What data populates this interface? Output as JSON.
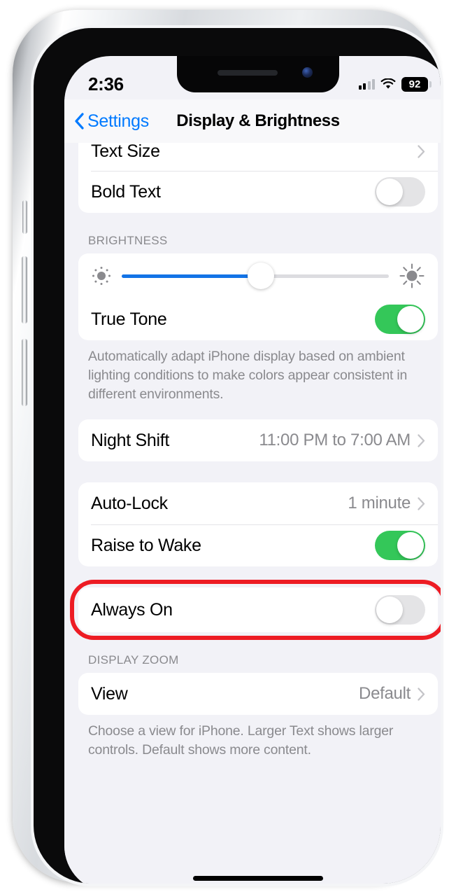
{
  "status_bar": {
    "time": "2:36",
    "battery_percent": "92",
    "wifi_icon": "wifi-icon",
    "signal_icon": "cellular-signal-icon",
    "battery_icon": "battery-icon"
  },
  "nav": {
    "back_label": "Settings",
    "back_icon": "chevron-left-icon",
    "title": "Display & Brightness"
  },
  "groups": {
    "text": {
      "rows": [
        {
          "label": "Text Size",
          "type": "disclosure",
          "value": "",
          "accessory_icon": "chevron-right-icon"
        },
        {
          "label": "Bold Text",
          "type": "toggle",
          "state": "off"
        }
      ]
    },
    "brightness": {
      "header": "BRIGHTNESS",
      "slider": {
        "value_percent": 52,
        "left_icon": "sun-small-icon",
        "right_icon": "sun-large-icon",
        "fill_color": "#1273e6",
        "track_color": "#dcdce0"
      },
      "rows": [
        {
          "label": "True Tone",
          "type": "toggle",
          "state": "on"
        }
      ],
      "footer": "Automatically adapt iPhone display based on ambient lighting conditions to make colors appear consistent in different environments."
    },
    "night_shift": {
      "rows": [
        {
          "label": "Night Shift",
          "type": "disclosure",
          "value": "11:00 PM to 7:00 AM",
          "accessory_icon": "chevron-right-icon"
        }
      ]
    },
    "lock": {
      "rows": [
        {
          "label": "Auto-Lock",
          "type": "disclosure",
          "value": "1 minute",
          "accessory_icon": "chevron-right-icon"
        },
        {
          "label": "Raise to Wake",
          "type": "toggle",
          "state": "on"
        }
      ]
    },
    "always_on": {
      "rows": [
        {
          "label": "Always On",
          "type": "toggle",
          "state": "off"
        }
      ],
      "highlight_color": "#ed1c24"
    },
    "display_zoom": {
      "header": "DISPLAY ZOOM",
      "rows": [
        {
          "label": "View",
          "type": "disclosure",
          "value": "Default",
          "accessory_icon": "chevron-right-icon"
        }
      ],
      "footer": "Choose a view for iPhone. Larger Text shows larger controls. Default shows more content."
    }
  },
  "colors": {
    "accent_blue": "#007aff",
    "toggle_on_green": "#34c759",
    "annotation_red": "#ed1c24",
    "background": "#f2f2f7"
  }
}
